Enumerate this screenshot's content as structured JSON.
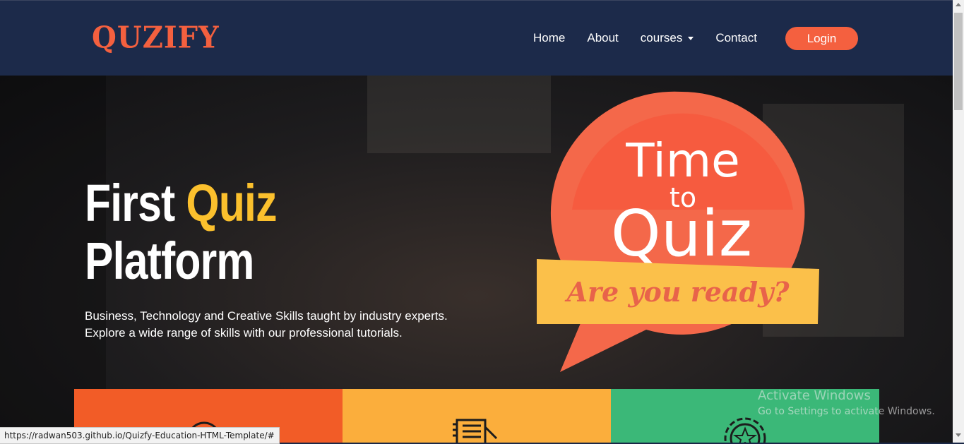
{
  "brand": {
    "name": "QUZIFY",
    "color": "#f4603f"
  },
  "nav": {
    "items": [
      {
        "label": "Home"
      },
      {
        "label": "About"
      },
      {
        "label": "courses",
        "has_dropdown": true
      },
      {
        "label": "Contact"
      }
    ],
    "login_label": "Login"
  },
  "hero": {
    "title_word1": "First",
    "title_accent": "Quiz",
    "title_line2": "Platform",
    "subtitle_line1": "Business, Technology and Creative Skills taught by industry experts.",
    "subtitle_line2": "Explore a wide range of skills with our professional tutorials.",
    "accent_color": "#fbc02d"
  },
  "bubble": {
    "line1": "Time",
    "line2": "to",
    "line3": "Quiz",
    "banner": "Are you ready?",
    "bubble_color": "#f4684a",
    "banner_color": "#fbc04a"
  },
  "feature_cards": [
    {
      "color": "#f25c27",
      "icon": "clock-icon"
    },
    {
      "color": "#fbae3c",
      "icon": "document-icon"
    },
    {
      "color": "#3bb878",
      "icon": "badge-icon"
    }
  ],
  "watermark": {
    "title": "Activate Windows",
    "subtitle": "Go to Settings to activate Windows."
  },
  "status_bar": {
    "url": "https://radwan503.github.io/Quizfy-Education-HTML-Template/#"
  }
}
